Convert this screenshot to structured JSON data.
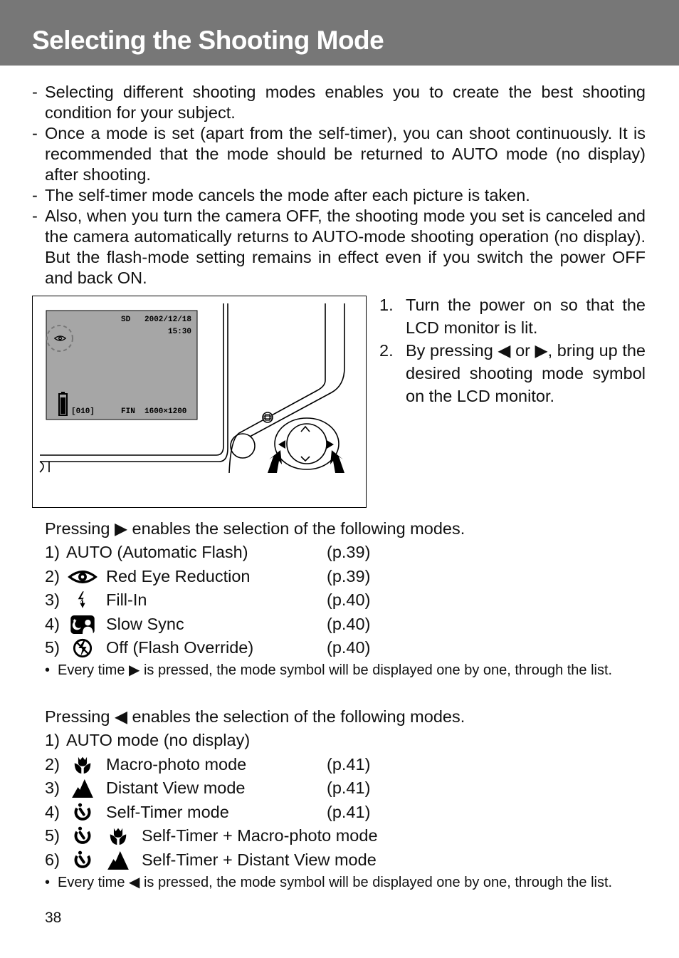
{
  "header": {
    "title": "Selecting the Shooting Mode",
    "background": "#777777"
  },
  "intro": [
    "Selecting different shooting modes enables you to create the best shooting condition for your subject.",
    "Once a mode is set (apart from the self-timer), you can shoot continuously. It is recommended that the mode should be returned to AUTO mode (no display) after shooting.",
    "The self-timer mode cancels the mode after each picture is taken.",
    "Also, when you turn the camera OFF, the shooting mode you set is canceled and the camera automatically returns to AUTO-mode shooting operation (no display). But the flash-mode setting remains in effect even if you switch the power OFF and back ON."
  ],
  "bullet_dash": "-",
  "lcd": {
    "media": "SD",
    "date": "2002/12/18",
    "time": "15:30",
    "counter": "[010]",
    "quality": "FIN",
    "resolution": "1600×1200",
    "mode_icon": "red-eye-icon"
  },
  "steps": [
    {
      "num": "1.",
      "text": "Turn the power on so that the LCD monitor is lit."
    },
    {
      "num": "2.",
      "text": "By pressing ◀ or ▶, bring up the desired shooting mode symbol on the LCD monitor."
    }
  ],
  "right_section": {
    "lead": "Pressing  ▶ enables the selection of the following modes.",
    "items": [
      {
        "num": "1)",
        "icon": "",
        "label": "AUTO (Automatic Flash)",
        "page": "(p.39)"
      },
      {
        "num": "2)",
        "icon": "red-eye-icon",
        "label": "Red Eye Reduction",
        "page": "(p.39)"
      },
      {
        "num": "3)",
        "icon": "fill-flash-icon",
        "label": "Fill-In",
        "page": "(p.40)"
      },
      {
        "num": "4)",
        "icon": "slow-sync-icon",
        "label": "Slow Sync",
        "page": "(p.40)"
      },
      {
        "num": "5)",
        "icon": "flash-off-icon",
        "label": "Off (Flash Override)",
        "page": "(p.40)"
      }
    ],
    "note": "Every time ▶ is pressed, the mode symbol will be displayed one by one, through the list."
  },
  "left_section": {
    "lead": "Pressing ◀ enables the selection of the following modes.",
    "items": [
      {
        "num": "1)",
        "icon": "",
        "label": "AUTO mode (no display)",
        "page": ""
      },
      {
        "num": "2)",
        "icon": "macro-icon",
        "label": "Macro-photo mode",
        "page": "(p.41)"
      },
      {
        "num": "3)",
        "icon": "mountain-icon",
        "label": "Distant View mode",
        "page": "(p.41)"
      },
      {
        "num": "4)",
        "icon": "self-timer-icon",
        "label": "Self-Timer mode",
        "page": "(p.41)"
      },
      {
        "num": "5)",
        "icon": "self-timer-icon + macro-icon",
        "label": "Self-Timer + Macro-photo mode",
        "page": ""
      },
      {
        "num": "6)",
        "icon": "self-timer-icon + mountain-icon",
        "label": "Self-Timer + Distant View mode",
        "page": ""
      }
    ],
    "note": "Every time ◀ is pressed, the mode symbol will be displayed one by one, through the list."
  },
  "note_bullet": "•",
  "page_number": "38"
}
